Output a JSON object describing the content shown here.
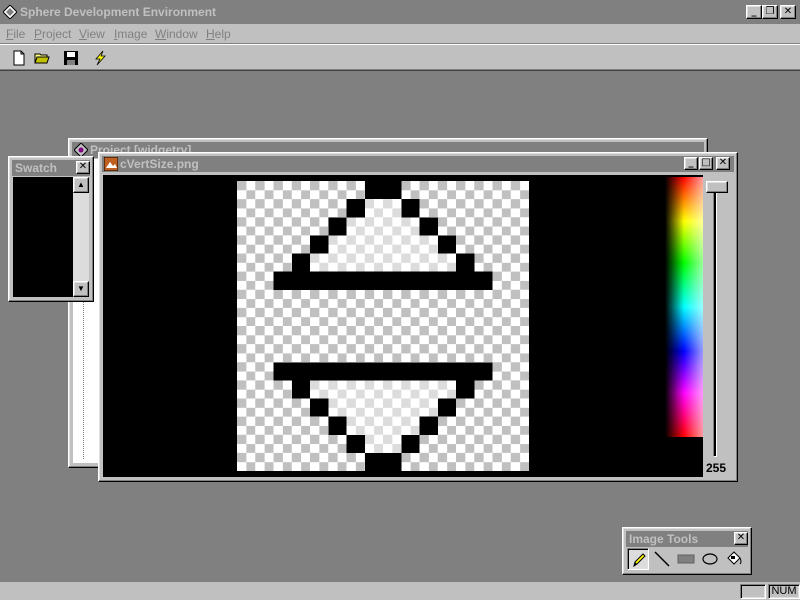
{
  "app": {
    "title": "Sphere Development Environment"
  },
  "menubar": {
    "items": [
      "File",
      "Project",
      "View",
      "Image",
      "Window",
      "Help"
    ]
  },
  "toolbar": {
    "buttons": [
      "new-file-icon",
      "open-folder-icon",
      "save-disk-icon",
      "lightning-icon"
    ]
  },
  "windows": {
    "project": {
      "title": "Project [widgetry]"
    },
    "image": {
      "title": "cVertSize.png",
      "alpha_value": "255"
    },
    "swatch": {
      "title": "Swatch"
    },
    "tools": {
      "title": "Image Tools",
      "buttons": [
        "pencil-icon",
        "line-icon",
        "rectangle-icon",
        "ellipse-icon",
        "fill-bucket-icon"
      ]
    }
  },
  "statusbar": {
    "num": "NUM"
  },
  "colors": {
    "inactive_title": "#808080",
    "face": "#c0c0c0",
    "mdi_background": "#808080"
  }
}
